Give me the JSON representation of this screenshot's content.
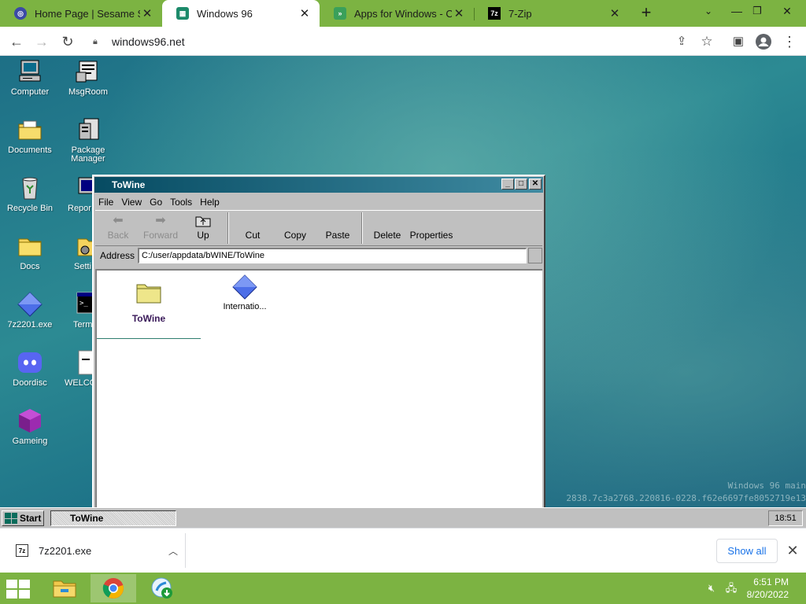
{
  "browser": {
    "tabs": [
      {
        "title": "Home Page | Sesame Str",
        "favicon": "sesame-icon",
        "active": false
      },
      {
        "title": "Windows 96",
        "favicon": "windows96-icon",
        "active": true
      },
      {
        "title": "Apps for Windows - CNE",
        "favicon": "cnet-icon",
        "active": false
      },
      {
        "title": "7-Zip",
        "favicon": "7zip-icon",
        "favicon_text": "7z",
        "active": false
      }
    ],
    "new_tab_label": "+",
    "url": "windows96.net"
  },
  "desktop": {
    "icons": [
      {
        "label": "Computer",
        "icon": "computer-icon"
      },
      {
        "label": "MsgRoom",
        "icon": "msgroom-icon"
      },
      {
        "label": "Documents",
        "icon": "documents-folder-icon"
      },
      {
        "label": "Package Manager",
        "icon": "package-manager-icon"
      },
      {
        "label": "Recycle Bin",
        "icon": "recycle-bin-icon"
      },
      {
        "label": "Repor",
        "icon": "report-icon"
      },
      {
        "label": "Docs",
        "icon": "docs-folder-icon"
      },
      {
        "label": "Setti",
        "icon": "settings-icon"
      },
      {
        "label": "7z2201.exe",
        "icon": "diamond-exe-icon"
      },
      {
        "label": "Term",
        "icon": "terminal-icon"
      },
      {
        "label": "Doordisc",
        "icon": "discord-icon"
      },
      {
        "label": "WELCO",
        "icon": "welcome-icon"
      },
      {
        "label": "Gameing",
        "icon": "game-cube-icon"
      }
    ],
    "watermark_line1": "Windows 96 main",
    "watermark_line2": "2838.7c3a2768.220816-0228.f62e6697fe8052719e13"
  },
  "explorer": {
    "title": "ToWine",
    "menu": [
      "File",
      "View",
      "Go",
      "Tools",
      "Help"
    ],
    "toolbar": {
      "back": "Back",
      "forward": "Forward",
      "up": "Up",
      "cut": "Cut",
      "copy": "Copy",
      "paste": "Paste",
      "delete": "Delete",
      "properties": "Properties"
    },
    "address_label": "Address",
    "address_value": "C:/user/appdata/bWINE/ToWine",
    "items": [
      {
        "label": "ToWine",
        "icon": "folder-icon"
      },
      {
        "label": "Internatio...",
        "icon": "diamond-exe-icon"
      }
    ]
  },
  "w96_taskbar": {
    "start_label": "Start",
    "task_label": "ToWine",
    "clock": "18:51"
  },
  "download_bar": {
    "file_icon_text": "7z",
    "file_name": "7z2201.exe",
    "show_all_label": "Show all"
  },
  "host_taskbar": {
    "time": "6:51 PM",
    "date": "8/20/2022"
  },
  "colors": {
    "chrome_frame": "#7cb342",
    "w96_title_start": "#064b62",
    "w96_title_end": "#3f8aa1",
    "link_blue": "#1a73e8"
  }
}
